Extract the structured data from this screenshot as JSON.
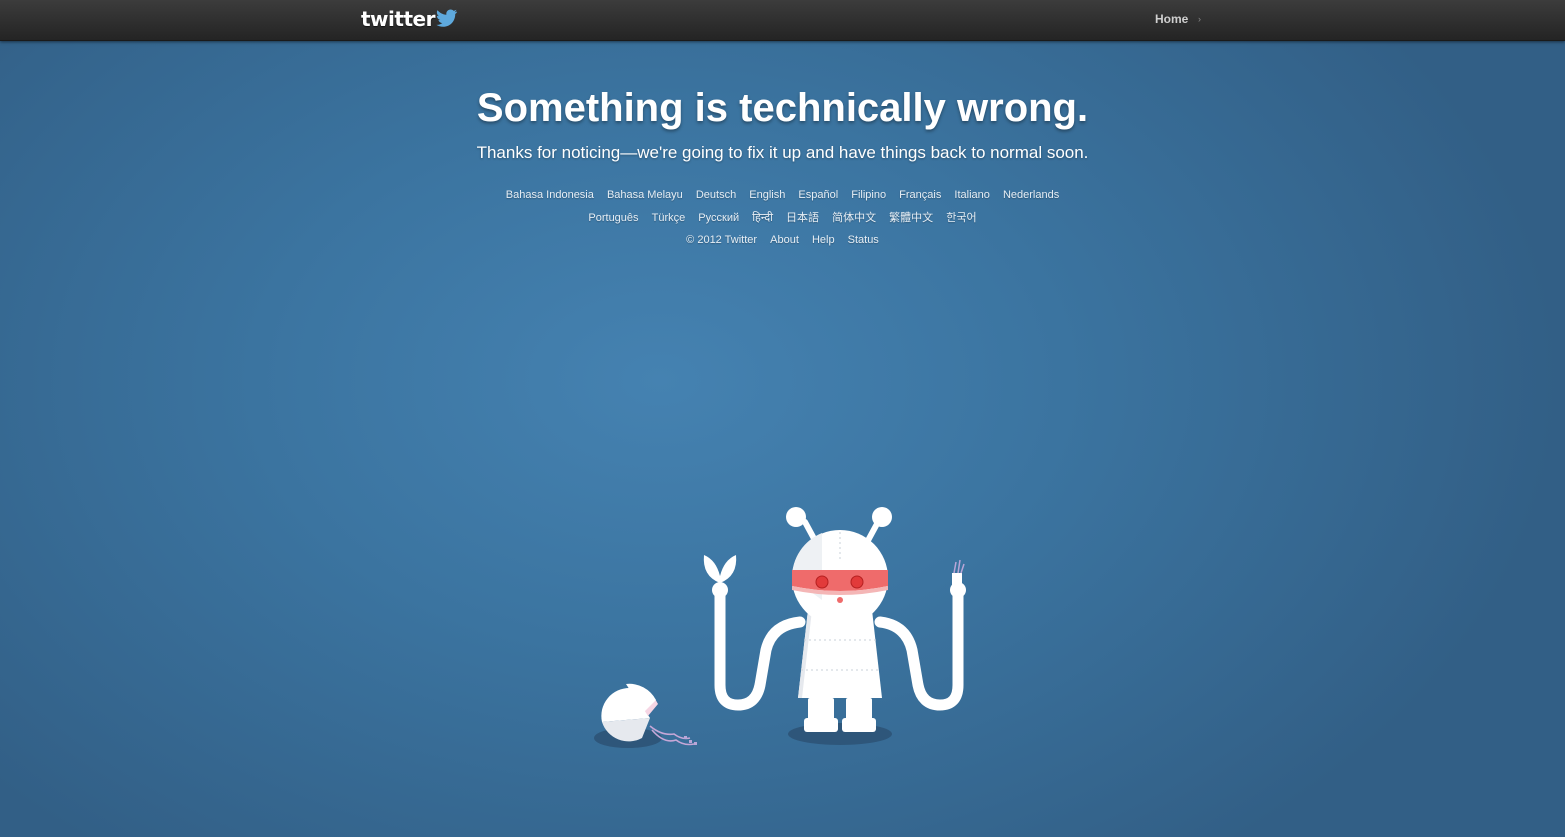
{
  "topbar": {
    "logo_text": "twitter",
    "home_label": "Home",
    "home_caret": "›"
  },
  "main": {
    "headline": "Something is technically wrong.",
    "subline": "Thanks for noticing—we're going to fix it up and have things back to normal soon."
  },
  "languages": {
    "row1": [
      "Bahasa Indonesia",
      "Bahasa Melayu",
      "Deutsch",
      "English",
      "Español",
      "Filipino",
      "Français",
      "Italiano",
      "Nederlands"
    ],
    "row2": [
      "Português",
      "Türkçe",
      "Русский",
      "हिन्दी",
      "日本語",
      "简体中文",
      "繁體中文",
      "한국어"
    ]
  },
  "footer": {
    "copyright": "© 2012 Twitter",
    "about": "About",
    "help": "Help",
    "status": "Status"
  },
  "illustration": {
    "icon": "broken-robot-illustration",
    "colors": {
      "robot_white": "#ffffff",
      "visor_red": "#ef6b6b",
      "eye_red": "#e23a3a",
      "shadow": "#2b4f70"
    }
  }
}
